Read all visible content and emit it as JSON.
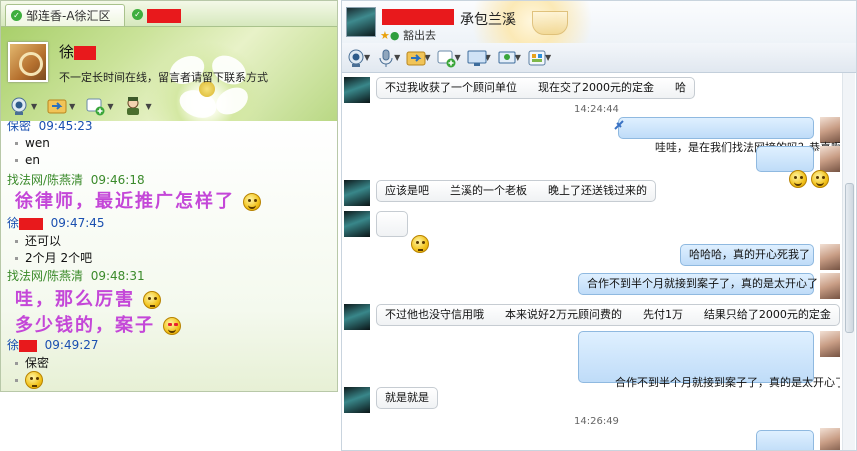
{
  "left": {
    "tabs": [
      {
        "label": "邹连香-A徐汇区"
      },
      {
        "label": ""
      }
    ],
    "contact": {
      "name": "徐",
      "signature": "不一定长时间在线，留言者请留下联系方式"
    },
    "messages": [
      {
        "sender": "保密",
        "time": "09:45:23"
      },
      {
        "text": "wen"
      },
      {
        "text": "en"
      },
      {
        "sender": "找法网/陈燕清",
        "time": "09:46:18"
      },
      {
        "text": "徐律师，最近推广怎样了"
      },
      {
        "sender": "徐",
        "time": "09:47:45"
      },
      {
        "text": "还可以"
      },
      {
        "text": "2个月 2个吧"
      },
      {
        "sender": "找法网/陈燕清",
        "time": "09:48:31"
      },
      {
        "text": "哇，那么厉害"
      },
      {
        "text": "多少钱的，案子"
      },
      {
        "sender": "徐",
        "time": "09:49:27"
      },
      {
        "text": "保密"
      }
    ]
  },
  "right": {
    "contact": {
      "name": "承包兰溪",
      "status": "豁出去"
    },
    "messages": [
      {
        "dir": "in",
        "text": "不过我收获了一个顾问单位      现在交了2000元的定金      哈"
      },
      {
        "time": "14:24:44"
      },
      {
        "dir": "out",
        "text": "哇哇，是在我们找法网接的吗？恭喜啊"
      },
      {
        "dir": "out",
        "text": ""
      },
      {
        "dir": "in",
        "text": "应该是吧      兰溪的一个老板      晚上了还送钱过来的"
      },
      {
        "dir": "in",
        "text": ""
      },
      {
        "dir": "out",
        "text": "哈哈哈，真的开心死我了"
      },
      {
        "dir": "out",
        "text": "合作不到半个月就接到案子了，真的是太开心了"
      },
      {
        "dir": "in",
        "text": "不过他也没守信用哦      本来说好2万元顾问费的      先付1万      结果只给了2000元的定金"
      },
      {
        "dir": "out",
        "text": "合作不到半个月就接到案子了，真的是太开心了"
      },
      {
        "dir": "in",
        "text": "就是就是"
      },
      {
        "time": "14:26:49"
      }
    ]
  },
  "colors": {
    "sender_green": "#3a8a2a",
    "self_name_blue": "#1a4fb0",
    "big_text_purple": "#c447d8",
    "redaction": "#e8191c"
  }
}
